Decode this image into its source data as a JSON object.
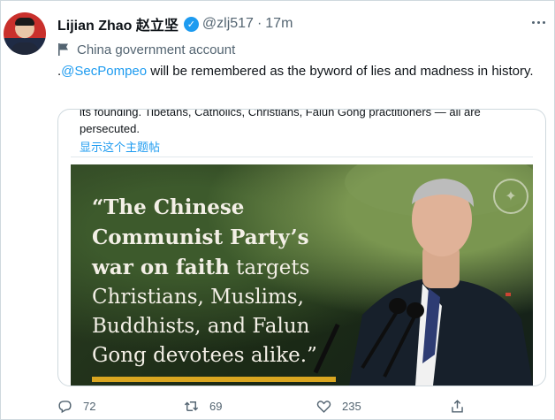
{
  "author": {
    "display_name": "Lijian Zhao 赵立坚",
    "handle": "@zlj517",
    "separator": "·",
    "time": "17m",
    "label": "China government account"
  },
  "tweet": {
    "prefix": ".",
    "mention": "@SecPompeo",
    "text_rest": " will be remembered as the byword of lies and madness in history."
  },
  "quoted": {
    "text": "its founding. Tibetans, Catholics, Christians, Falun Gong practitioners — all are persecuted.",
    "show_thread": "显示这个主题帖",
    "image_quote": {
      "line1": "“The Chinese",
      "line2": "Communist Party’s",
      "line3_bold": "war on faith",
      "line3_rest": " targets",
      "line4": "Christians, Muslims,",
      "line5": "Buddhists, and Falun",
      "line6": "Gong devotees alike.”"
    }
  },
  "actions": {
    "reply_count": "72",
    "retweet_count": "69",
    "like_count": "235"
  },
  "icons": [
    "more-icon",
    "verified-icon",
    "flag-icon",
    "reply-icon",
    "retweet-icon",
    "like-icon",
    "share-icon"
  ],
  "colors": {
    "accent": "#1d9bf0",
    "muted": "#536471",
    "gold": "#d9a620"
  }
}
